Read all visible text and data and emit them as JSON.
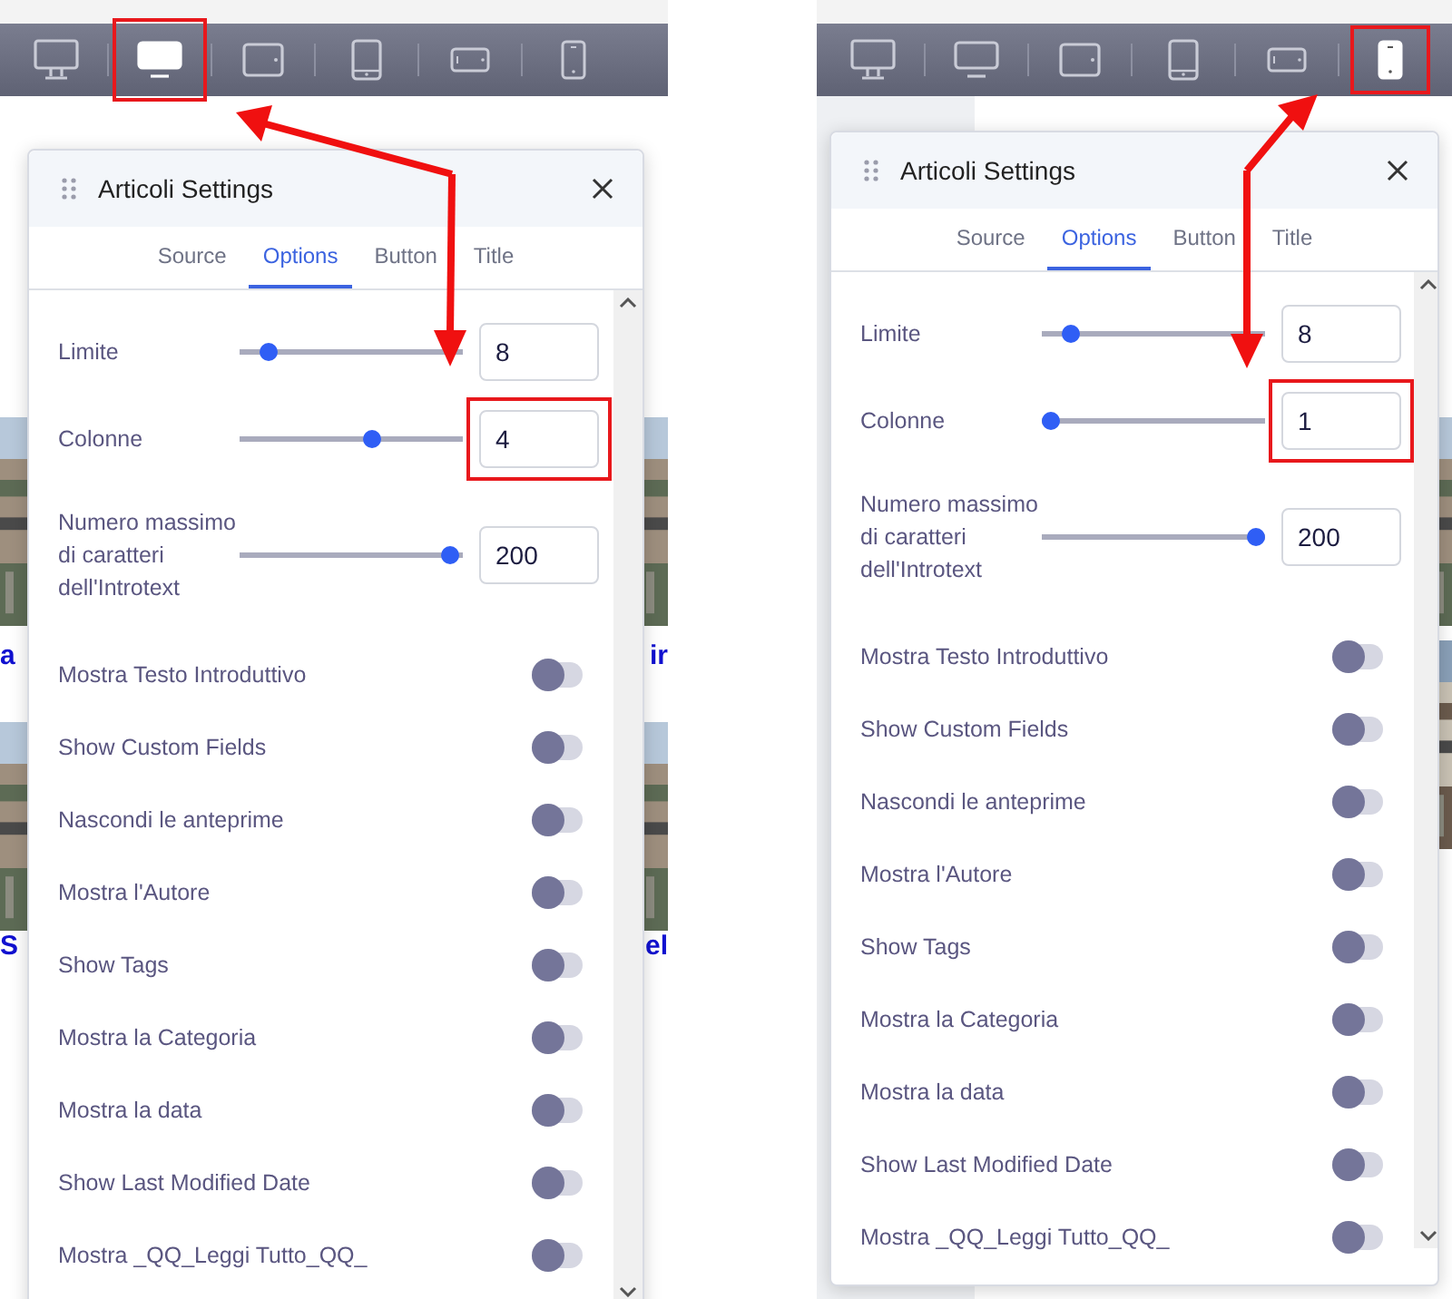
{
  "views": [
    {
      "devices": [
        {
          "kind": "desktop",
          "selected": false
        },
        {
          "kind": "screen",
          "selected": true
        },
        {
          "kind": "tablet-landscape",
          "selected": false
        },
        {
          "kind": "tablet",
          "selected": false
        },
        {
          "kind": "phone-landscape",
          "selected": false
        },
        {
          "kind": "phone",
          "selected": false
        }
      ],
      "page_left": [
        {
          "kind": "picture"
        },
        {
          "kind": "link",
          "text": "a"
        },
        {
          "kind": "picture"
        },
        {
          "kind": "link",
          "text": "S"
        }
      ],
      "page_right": [
        {
          "kind": "picture"
        },
        {
          "kind": "link",
          "text": "ir"
        },
        {
          "kind": "picture"
        },
        {
          "kind": "link",
          "text": "el"
        }
      ],
      "panel": {
        "title": "Articoli Settings",
        "tabs": [
          {
            "label": "Source",
            "selected": false
          },
          {
            "label": "Options",
            "selected": true
          },
          {
            "label": "Button",
            "selected": false
          },
          {
            "label": "Title",
            "selected": false
          }
        ],
        "sliders": [
          {
            "label": "Limite",
            "level": 0.1,
            "value": "8",
            "highlighted": false
          },
          {
            "label": "Colonne",
            "level": 0.6,
            "value": "4",
            "highlighted": true
          },
          {
            "label": "Numero massimo di caratteri dell'Introtext",
            "level": 0.98,
            "value": "200",
            "highlighted": false
          }
        ],
        "toggles": [
          {
            "label": "Mostra Testo Introduttivo",
            "on": false
          },
          {
            "label": "Show Custom Fields",
            "on": false
          },
          {
            "label": "Nascondi le anteprime",
            "on": false
          },
          {
            "label": "Mostra l'Autore",
            "on": false
          },
          {
            "label": "Show Tags",
            "on": false
          },
          {
            "label": "Mostra la Categoria",
            "on": false
          },
          {
            "label": "Mostra la data",
            "on": false
          },
          {
            "label": "Show Last Modified Date",
            "on": false
          },
          {
            "label": "Mostra _QQ_Leggi Tutto_QQ_",
            "on": false
          }
        ]
      }
    },
    {
      "devices": [
        {
          "kind": "desktop",
          "selected": false
        },
        {
          "kind": "screen",
          "selected": false
        },
        {
          "kind": "tablet-landscape",
          "selected": false
        },
        {
          "kind": "tablet",
          "selected": false
        },
        {
          "kind": "phone-landscape",
          "selected": false
        },
        {
          "kind": "phone",
          "selected": true
        }
      ],
      "page_right": [
        {
          "kind": "picture"
        },
        {
          "kind": "picture"
        }
      ],
      "panel": {
        "title": "Articoli Settings",
        "tabs": [
          {
            "label": "Source",
            "selected": false
          },
          {
            "label": "Options",
            "selected": true
          },
          {
            "label": "Button",
            "selected": false
          },
          {
            "label": "Title",
            "selected": false
          }
        ],
        "sliders": [
          {
            "label": "Limite",
            "level": 0.1,
            "value": "8",
            "highlighted": false
          },
          {
            "label": "Colonne",
            "level": 0.0,
            "value": "1",
            "highlighted": true
          },
          {
            "label": "Numero massimo di caratteri dell'Introtext",
            "level": 1.0,
            "value": "200",
            "highlighted": false
          }
        ],
        "toggles": [
          {
            "label": "Mostra Testo Introduttivo",
            "on": false
          },
          {
            "label": "Show Custom Fields",
            "on": false
          },
          {
            "label": "Nascondi le anteprime",
            "on": false
          },
          {
            "label": "Mostra l'Autore",
            "on": false
          },
          {
            "label": "Show Tags",
            "on": false
          },
          {
            "label": "Mostra la Categoria",
            "on": false
          },
          {
            "label": "Mostra la data",
            "on": false
          },
          {
            "label": "Show Last Modified Date",
            "on": false
          },
          {
            "label": "Mostra _QQ_Leggi Tutto_QQ_",
            "on": false
          }
        ]
      }
    }
  ]
}
